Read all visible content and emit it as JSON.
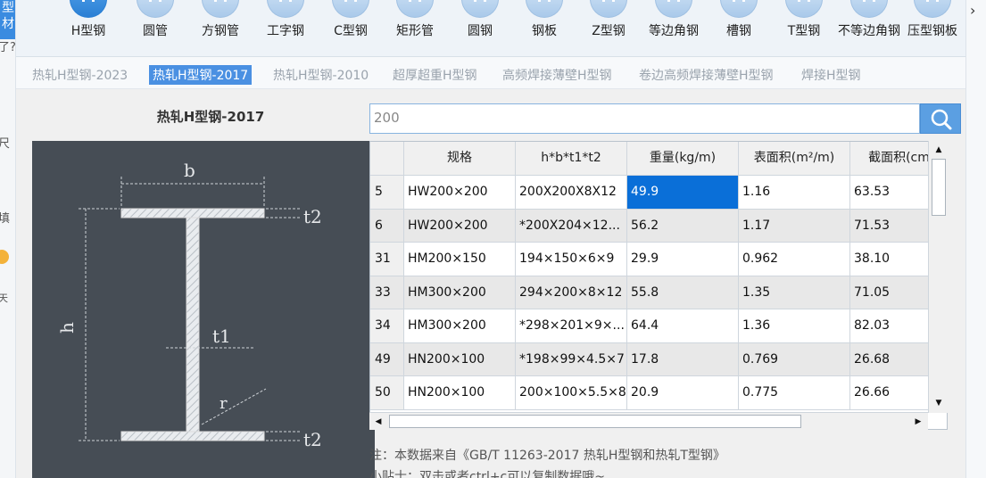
{
  "left_strip": {
    "logo": "型材",
    "fragments": [
      "了?",
      "尺",
      "填",
      "天"
    ]
  },
  "toolbar": {
    "tools": [
      {
        "label": "H型钢",
        "active": true
      },
      {
        "label": "圆管"
      },
      {
        "label": "方钢管"
      },
      {
        "label": "工字钢"
      },
      {
        "label": "C型钢"
      },
      {
        "label": "矩形管"
      },
      {
        "label": "圆钢"
      },
      {
        "label": "钢板"
      },
      {
        "label": "Z型钢"
      },
      {
        "label": "等边角钢"
      },
      {
        "label": "槽钢"
      },
      {
        "label": "T型钢"
      },
      {
        "label": "不等边角钢"
      },
      {
        "label": "压型钢板"
      }
    ],
    "more_arrow": "›"
  },
  "subtabs": [
    {
      "label": "热轧H型钢-2023"
    },
    {
      "label": "热轧H型钢-2017",
      "active": true
    },
    {
      "label": "热轧H型钢-2010"
    },
    {
      "label": "超厚超重H型钢"
    },
    {
      "label": "高频焊接薄壁H型钢"
    },
    {
      "label": "卷边高频焊接薄壁H型钢"
    },
    {
      "label": "焊接H型钢"
    }
  ],
  "diagram": {
    "title": "热轧H型钢-2017",
    "labels": {
      "b": "b",
      "h": "h",
      "t1": "t1",
      "t2_top": "t2",
      "t2_bottom": "t2",
      "r": "r"
    }
  },
  "search": {
    "value": "200",
    "icon": "search-icon"
  },
  "table": {
    "headers": [
      "规格",
      "h*b*t1*t2",
      "重量(kg/m)",
      "表面积(m²/m)",
      "截面积(cm"
    ],
    "rows": [
      {
        "num": "5",
        "cells": [
          "HW200×200",
          "200X200X8X12",
          "49.9",
          "1.16",
          "63.53"
        ]
      },
      {
        "num": "6",
        "cells": [
          "HW200×200",
          "*200X204×12...",
          "56.2",
          "1.17",
          "71.53"
        ]
      },
      {
        "num": "31",
        "cells": [
          "HM200×150",
          "194×150×6×9",
          "29.9",
          "0.962",
          "38.10"
        ]
      },
      {
        "num": "33",
        "cells": [
          "HM300×200",
          "294×200×8×12",
          "55.8",
          "1.35",
          "71.05"
        ]
      },
      {
        "num": "34",
        "cells": [
          "HM300×200",
          "*298×201×9×...",
          "64.4",
          "1.36",
          "82.03"
        ]
      },
      {
        "num": "49",
        "cells": [
          "HN200×100",
          "*198×99×4.5×7",
          "17.8",
          "0.769",
          "26.68"
        ]
      },
      {
        "num": "50",
        "cells": [
          "HN200×100",
          "200×100×5.5×8",
          "20.9",
          "0.775",
          "26.66"
        ]
      }
    ]
  },
  "note": "注：本数据来自《GB/T 11263-2017 热轧H型钢和热轧T型钢》",
  "tip": "小贴士：双击或者ctrl+c可以复制数据哦~"
}
